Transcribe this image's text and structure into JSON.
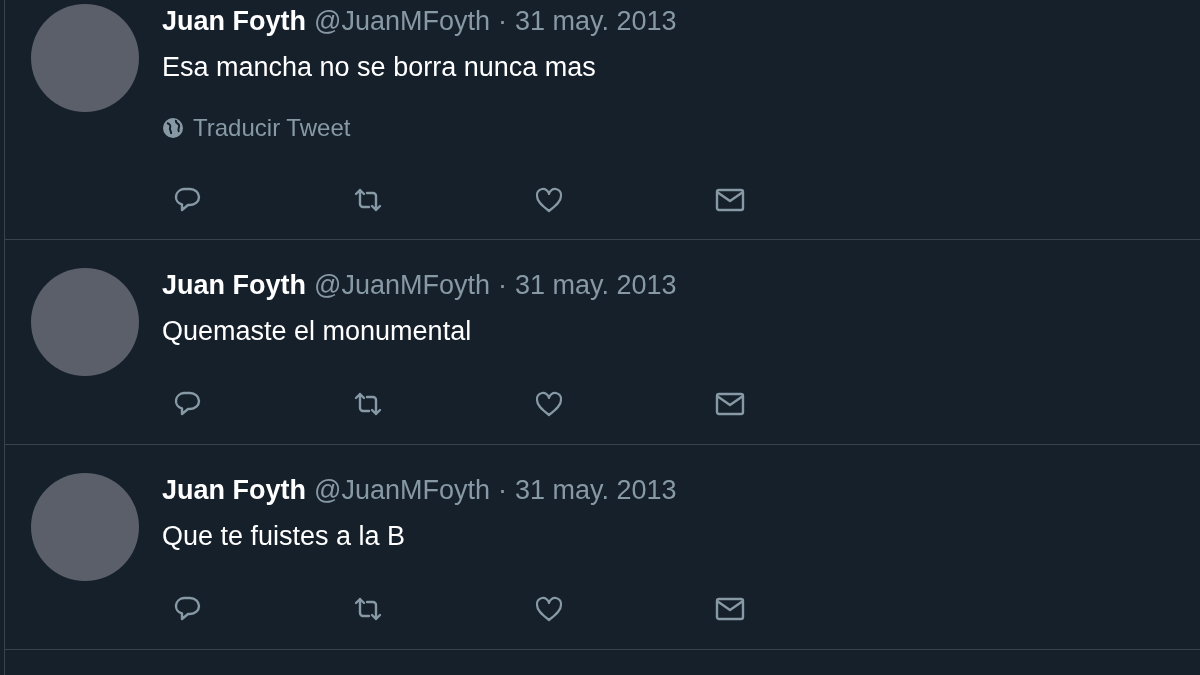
{
  "tweets": [
    {
      "name": "Juan Foyth",
      "handle": "@JuanMFoyth",
      "separator": "·",
      "date": "31 may. 2013",
      "text": "Esa mancha no se borra nunca mas",
      "translate_link": "Traducir Tweet"
    },
    {
      "name": "Juan Foyth",
      "handle": "@JuanMFoyth",
      "separator": "·",
      "date": "31 may. 2013",
      "text": "Quemaste el monumental"
    },
    {
      "name": "Juan Foyth",
      "handle": "@JuanMFoyth",
      "separator": "·",
      "date": "31 may. 2013",
      "text": "Que te fuistes a la B"
    }
  ]
}
